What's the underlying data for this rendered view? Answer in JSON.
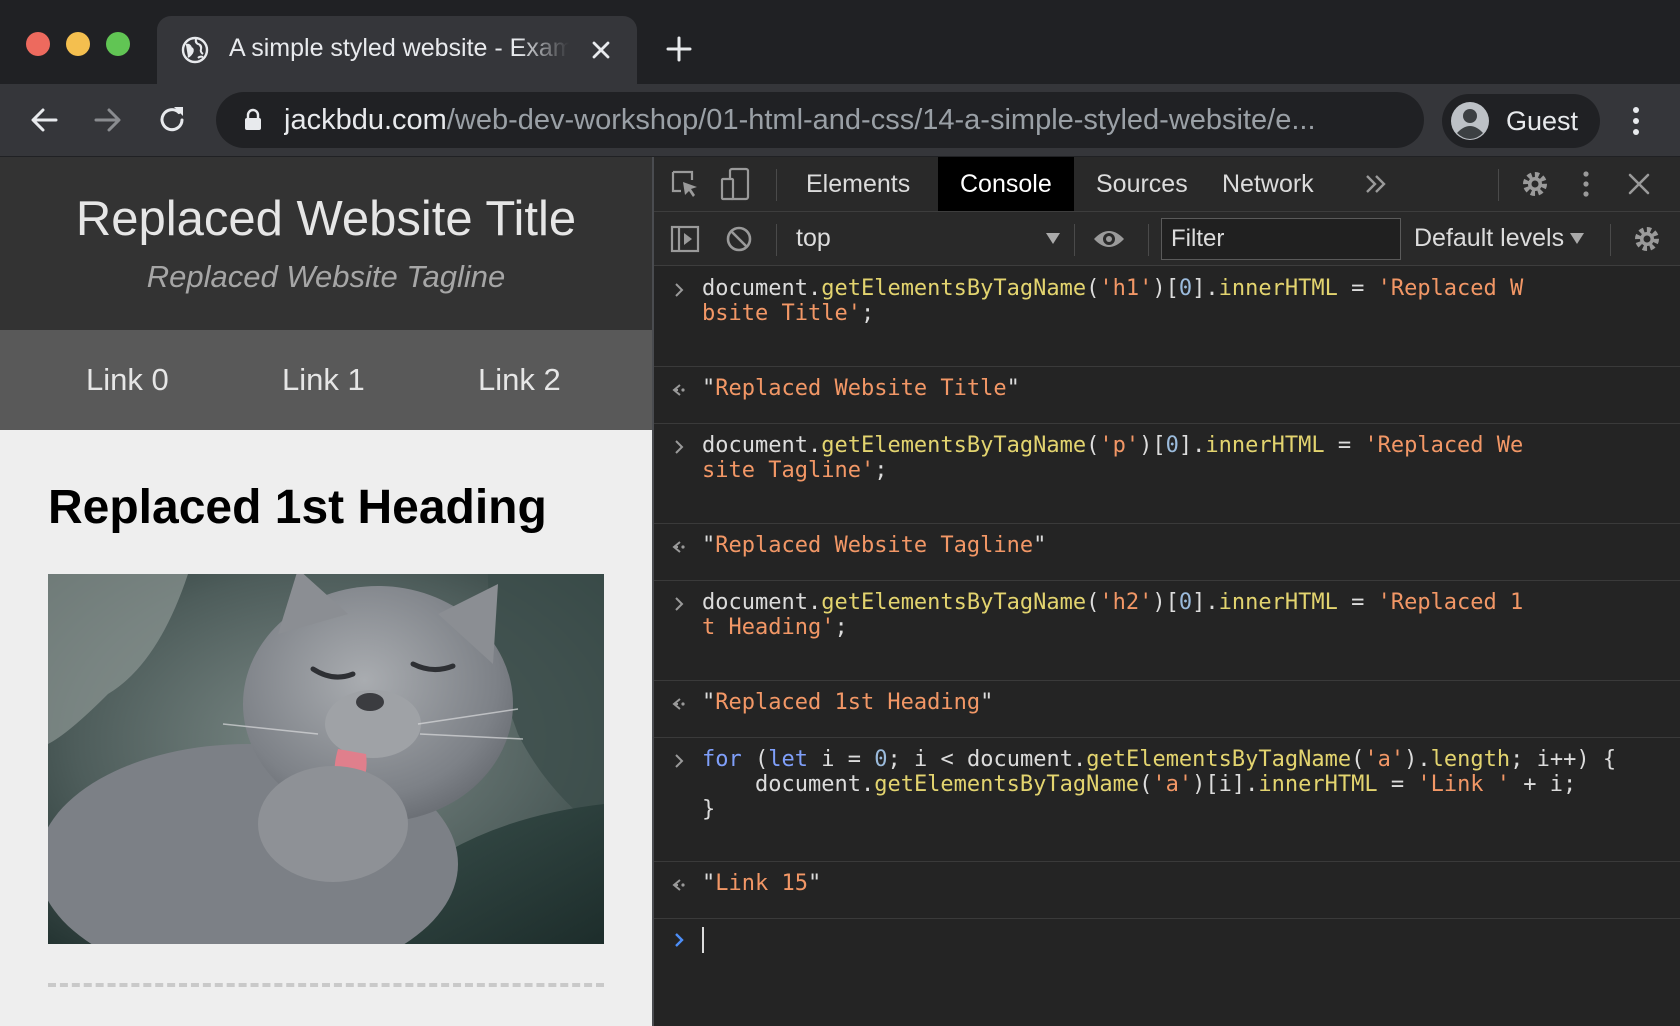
{
  "browser": {
    "tab_title": "A simple styled website - Example",
    "url_host": "jackbdu.com",
    "url_path": "/web-dev-workshop/01-html-and-css/14-a-simple-styled-website/e...",
    "profile_name": "Guest"
  },
  "page": {
    "site_title": "Replaced Website Title",
    "site_tagline": "Replaced Website Tagline",
    "nav_links": [
      "Link 0",
      "Link 1",
      "Link 2"
    ],
    "heading": "Replaced 1st Heading",
    "image_alt": "gray cat licking paw"
  },
  "devtools": {
    "tabs": [
      "Elements",
      "Console",
      "Sources",
      "Network"
    ],
    "active_tab": "Console",
    "more_tabs_icon": "chevron-double-right-icon",
    "context": "top",
    "filter_placeholder": "Filter",
    "levels_label": "Default levels"
  },
  "console": {
    "entries": [
      {
        "type": "input",
        "text": "document.getElementsByTagName('h1')[0].innerHTML = 'Replaced Website Title';"
      },
      {
        "type": "output",
        "text": "\"Replaced Website Title\""
      },
      {
        "type": "input",
        "text": "document.getElementsByTagName('p')[0].innerHTML = 'Replaced Website Tagline';"
      },
      {
        "type": "output",
        "text": "\"Replaced Website Tagline\""
      },
      {
        "type": "input",
        "text": "document.getElementsByTagName('h2')[0].innerHTML = 'Replaced 1st Heading';"
      },
      {
        "type": "output",
        "text": "\"Replaced 1st Heading\""
      },
      {
        "type": "input",
        "text": "for (let i = 0; i < document.getElementsByTagName('a').length; i++) {\n    document.getElementsByTagName('a')[i].innerHTML = 'Link ' + i;\n}"
      },
      {
        "type": "output",
        "text": "\"Link 15\""
      }
    ]
  },
  "colors": {
    "chrome_bg": "#202124",
    "toolbar_bg": "#35363a",
    "site_header_bg": "#333333",
    "site_nav_bg": "#595959",
    "page_bg": "#eeeeee",
    "devtools_bg": "#242424",
    "string": "#f29766",
    "function": "#e3d46f",
    "keyword": "#7f9ffa",
    "prompt_active": "#4d8ef7"
  }
}
